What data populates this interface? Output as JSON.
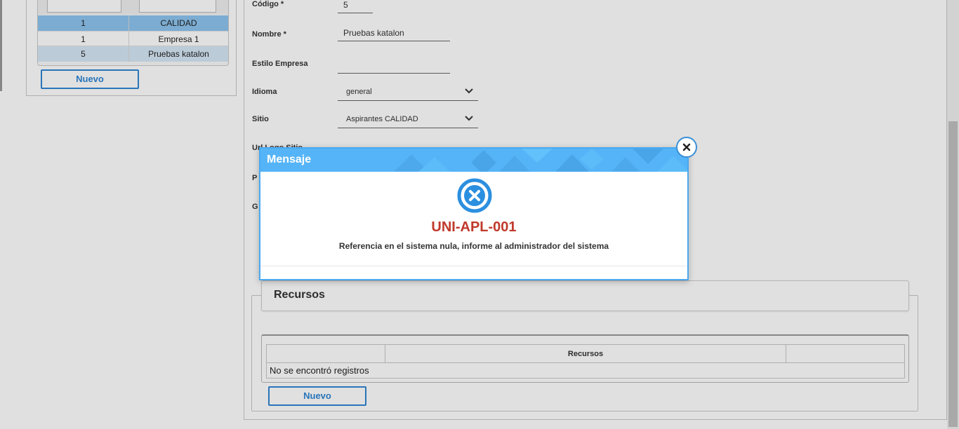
{
  "left_panel": {
    "rows": [
      {
        "code": "1",
        "name": "CALIDAD"
      },
      {
        "code": "1",
        "name": "Empresa 1"
      },
      {
        "code": "5",
        "name": "Pruebas katalon"
      }
    ],
    "new_button": "Nuevo"
  },
  "form": {
    "codigo_label": "Código *",
    "codigo_value": "5",
    "nombre_label": "Nombre *",
    "nombre_value": "Pruebas katalon",
    "estilo_label": "Estilo Empresa",
    "estilo_value": "",
    "idioma_label": "Idioma",
    "idioma_value": "general",
    "sitio_label": "Sitio",
    "sitio_value": "Aspirantes CALIDAD",
    "url_logo_label": "Url Logo Sitio",
    "hidden_label_1": "P",
    "hidden_label_2": "G"
  },
  "recursos": {
    "title": "Recursos",
    "column_header": "Recursos",
    "empty_message": "No se encontró registros",
    "new_button": "Nuevo"
  },
  "modal": {
    "title": "Mensaje",
    "code": "UNI-APL-001",
    "message": "Referencia en el sistema nula, informe al administrador del sistema",
    "icon": "error-x-circle-icon",
    "close_icon": "close-icon"
  },
  "colors": {
    "accent": "#2f86d4",
    "modal_header": "#55b4f7",
    "error_code": "#c0392b",
    "selected_row": "#8ec4ef",
    "alt_row": "#d6e8f6"
  }
}
